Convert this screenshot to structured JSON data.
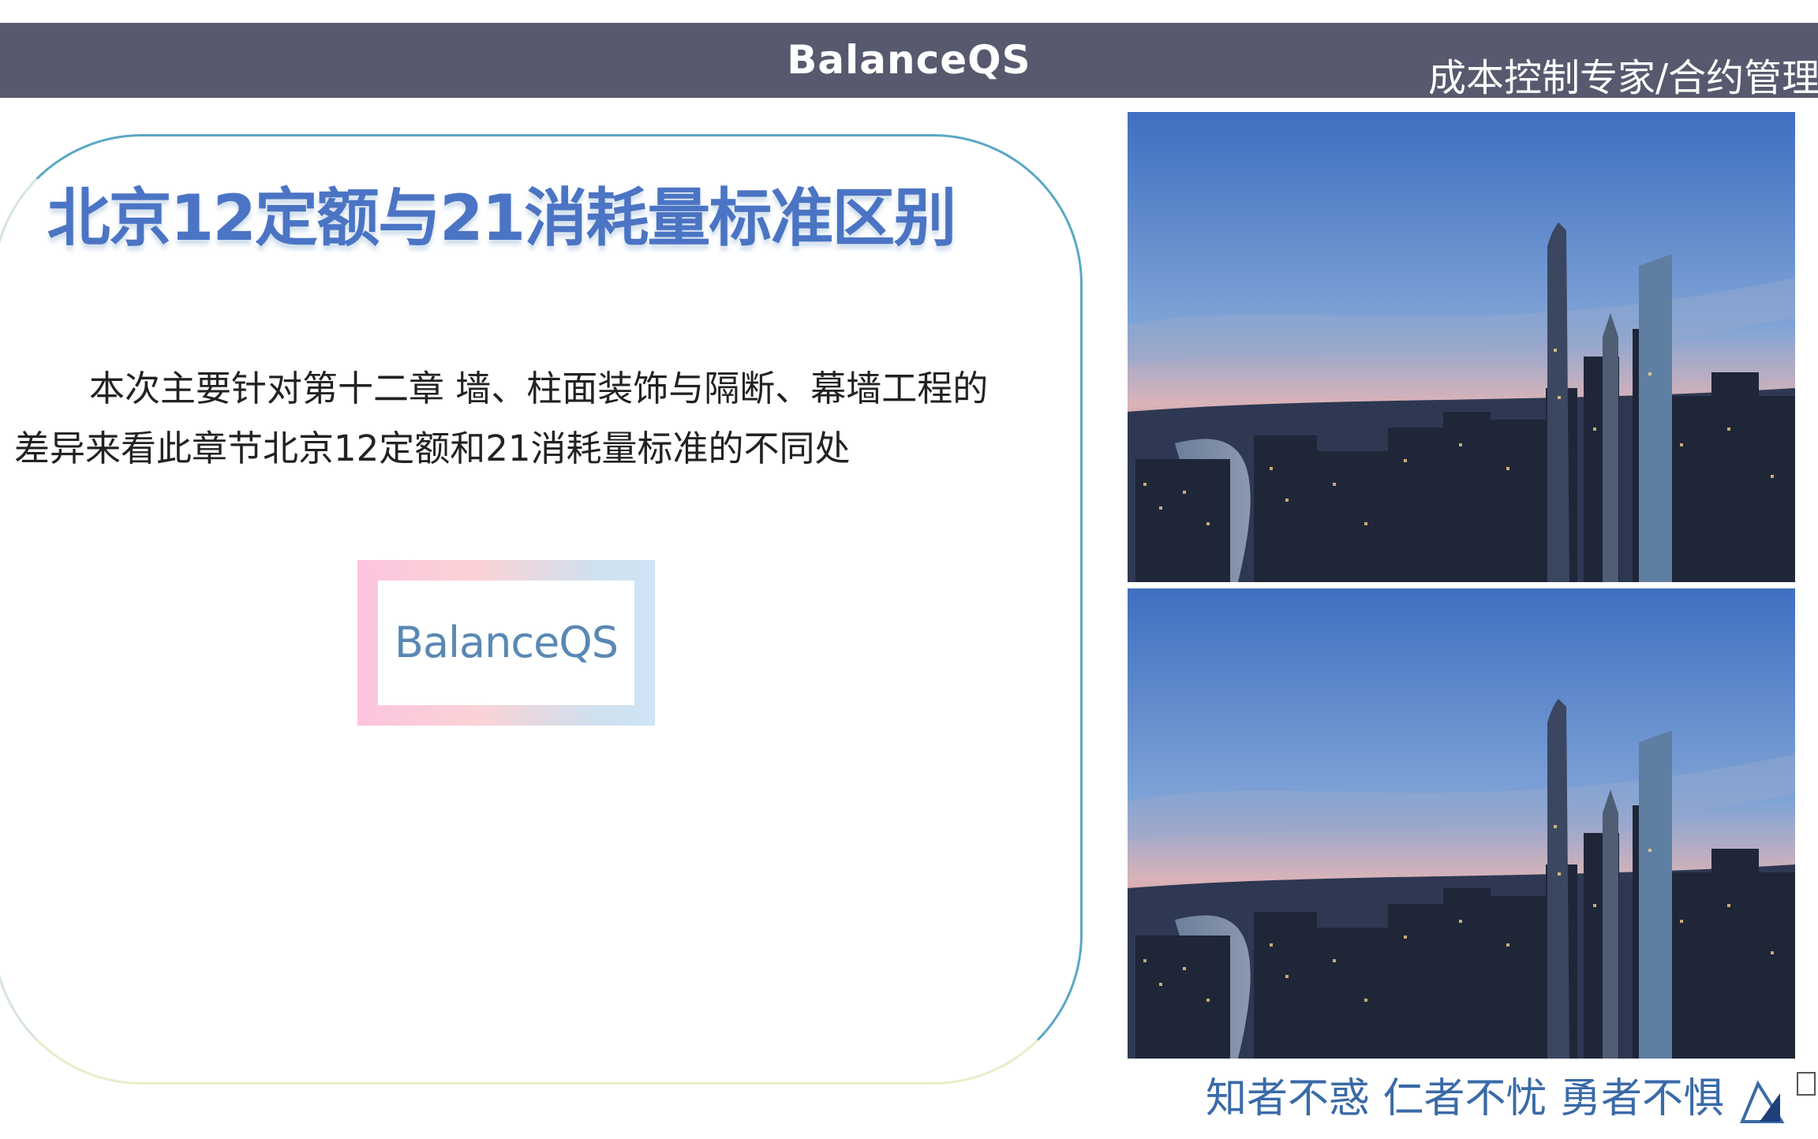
{
  "header": {
    "brand": "BalanceQS",
    "slogan": "成本控制专家/合约管理"
  },
  "slide": {
    "title": "北京12定额与21消耗量标准区别",
    "paragraph": "本次主要针对第十二章  墙、柱面装饰与隔断、幕墙工程的差异来看此章节北京12定额和21消耗量标准的不同处",
    "logo_text": "BalanceQS"
  },
  "photos": [
    {
      "subject": "city-skyline-dusk"
    },
    {
      "subject": "city-skyline-dusk"
    }
  ],
  "footer": {
    "motto": "知者不惑 仁者不忧 勇者不惧"
  },
  "colors": {
    "header_bar": "#575a6e",
    "title_blue": "#4b74c4",
    "frame": "#5aa8c4",
    "motto_blue": "#3a6aa8"
  }
}
